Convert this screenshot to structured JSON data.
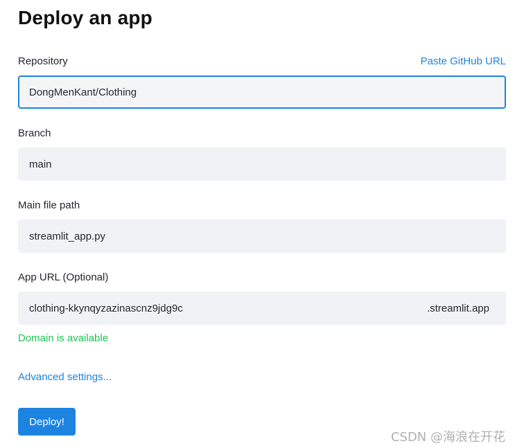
{
  "title": "Deploy an app",
  "repository": {
    "label": "Repository",
    "paste_link": "Paste GitHub URL",
    "value": "DongMenKant/Clothing"
  },
  "branch": {
    "label": "Branch",
    "value": "main"
  },
  "main_file": {
    "label": "Main file path",
    "value": "streamlit_app.py"
  },
  "app_url": {
    "label": "App URL (Optional)",
    "value": "clothing-kkynqyzazinascnz9jdg9c",
    "suffix": ".streamlit.app",
    "status": "Domain is available",
    "status_color": "#21c354"
  },
  "advanced_link": "Advanced settings...",
  "deploy_button": "Deploy!",
  "watermark": "CSDN @海浪在开花",
  "colors": {
    "accent": "#1c83e1",
    "input_bg": "#f0f2f6",
    "success": "#21c354"
  }
}
